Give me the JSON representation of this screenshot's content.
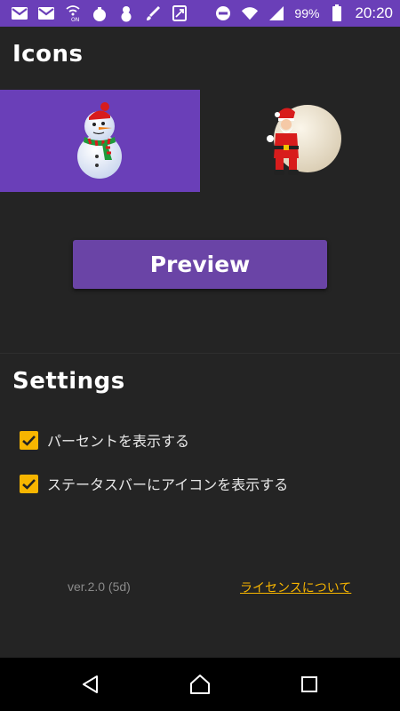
{
  "status_bar": {
    "left_icons": [
      "gmail-icon",
      "gmail-icon",
      "wifi-calling-icon",
      "bag-icon",
      "snowman-icon",
      "brush-icon",
      "cast-icon"
    ],
    "right_icons": [
      "do-not-disturb-icon",
      "wifi-icon",
      "signal-icon",
      "battery-icon"
    ],
    "battery": "99%",
    "time": "20:20",
    "color": "#6a3fb8"
  },
  "icons_section": {
    "title": "Icons",
    "items": [
      {
        "name": "snowman",
        "selected": true
      },
      {
        "name": "santa-with-sack",
        "selected": false
      }
    ],
    "selected_color": "#6a3fb8"
  },
  "preview_button": {
    "label": "Preview",
    "color": "#6a44a6"
  },
  "settings_section": {
    "title": "Settings",
    "options": [
      {
        "label": "パーセントを表示する",
        "checked": true
      },
      {
        "label": "ステータスバーにアイコンを表示する",
        "checked": true
      }
    ],
    "checkbox_color": "#f7b500"
  },
  "footer": {
    "version": "ver.2.0 (5d)",
    "license_link": "ライセンスについて",
    "link_color": "#f7b500"
  },
  "nav_bar": {
    "buttons": [
      "back-icon",
      "home-icon",
      "recents-icon"
    ]
  }
}
